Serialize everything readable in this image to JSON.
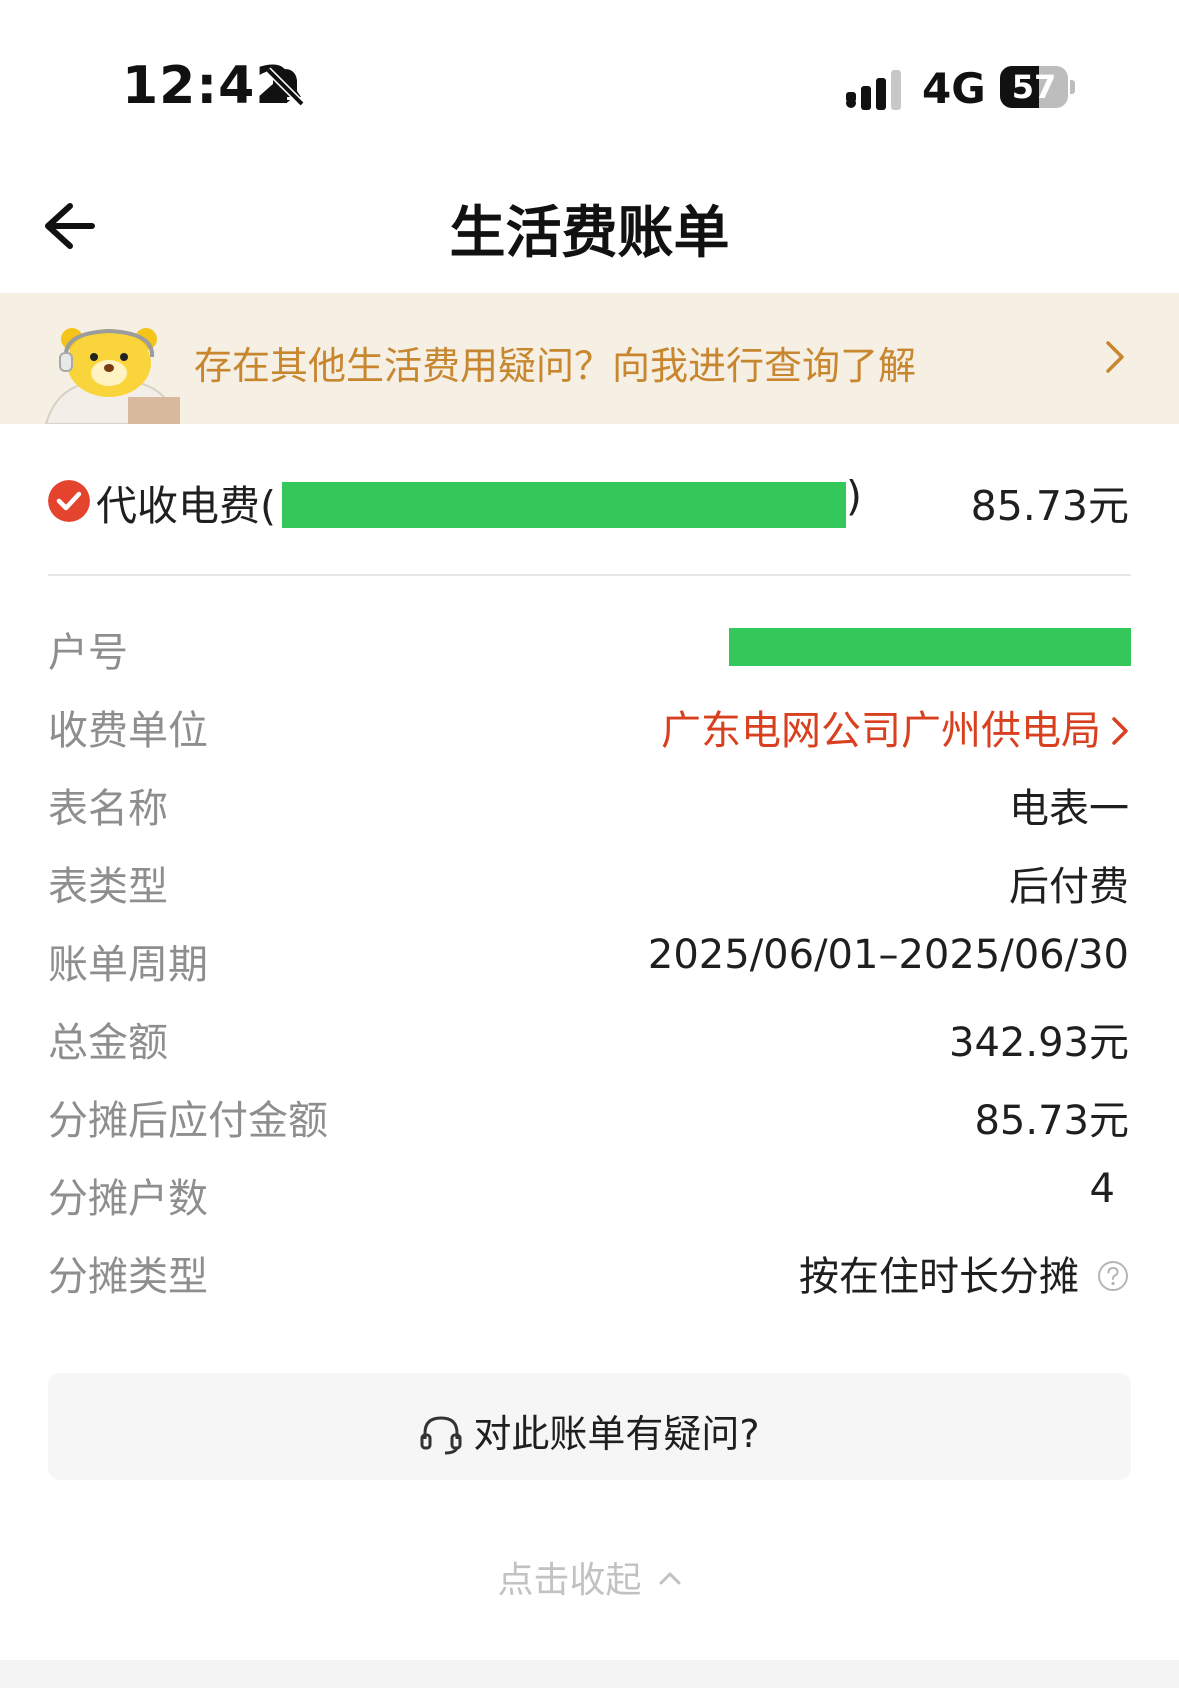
{
  "status_bar": {
    "time": "12:42",
    "network": "4G",
    "battery": "57",
    "battery_level": 0.57
  },
  "header": {
    "title": "生活费账单"
  },
  "banner": {
    "text": "存在其他生活费用疑问？向我进行查询了解"
  },
  "bill": {
    "name_prefix": "代收电费(",
    "name_suffix": ")",
    "amount": "85.73元"
  },
  "details": [
    {
      "label": "户号",
      "value": ""
    },
    {
      "label": "收费单位",
      "value": "广东电网公司广州供电局"
    },
    {
      "label": "表名称",
      "value": "电表一"
    },
    {
      "label": "表类型",
      "value": "后付费"
    },
    {
      "label": "账单周期",
      "value": "2025/06/01–2025/06/30"
    },
    {
      "label": "总金额",
      "value": "342.93元"
    },
    {
      "label": "分摊后应付金额",
      "value": "85.73元"
    },
    {
      "label": "分摊户数",
      "value": "4"
    },
    {
      "label": "分摊类型",
      "value": "按在住时长分摊"
    }
  ],
  "question_button": {
    "label": "对此账单有疑问?"
  },
  "collapse": {
    "label": "点击收起"
  },
  "colors": {
    "accent_red": "#d9401f",
    "banner_bg": "#f5efe4",
    "banner_text": "#c8862e",
    "mask_green": "#34c759"
  }
}
